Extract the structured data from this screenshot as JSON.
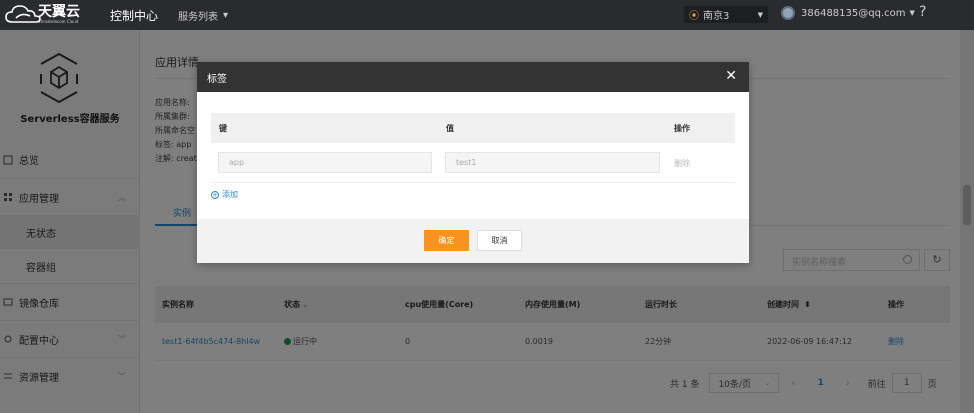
{
  "topbar": {
    "logo_cn": "天翼云",
    "logo_en": "Chinatelecom Cloud",
    "console": "控制中心",
    "services": "服务列表",
    "region": "南京3",
    "user_email": "386488135@qq.com",
    "help": "?"
  },
  "sidebar": {
    "service_title": "Serverless容器服务",
    "items": {
      "overview": "总览",
      "app_mgmt": "应用管理",
      "stateless": "无状态",
      "container_group": "容器组",
      "image_repo": "镜像仓库",
      "config_center": "配置中心",
      "resource_mgmt": "资源管理"
    }
  },
  "main": {
    "title": "应用详情",
    "info": {
      "app_name": "应用名称:",
      "cluster": "所属集群:",
      "namespace": "所属命名空",
      "labels": "标签: app",
      "annotations": "注解: creat"
    },
    "tab_instances": "实例",
    "search_placeholder": "实例名称搜索",
    "table": {
      "headers": [
        "实例名称",
        "状态",
        "cpu使用量(Core)",
        "内存使用量(M)",
        "运行时长",
        "创建时间",
        "操作"
      ],
      "rows": [
        {
          "name": "test1-64f4b5c474-8hl4w",
          "status": "运行中",
          "cpu": "0",
          "memory": "0.0019",
          "uptime": "22分钟",
          "created": "2022-06-09 16:47:12",
          "action": "删除"
        }
      ]
    },
    "pager": {
      "total": "共 1 条",
      "page_size": "10条/页",
      "current_page": "1",
      "goto_label": "前往",
      "goto_value": "1",
      "page_suffix": "页"
    }
  },
  "dialog": {
    "title": "标签",
    "col_key": "键",
    "col_value": "值",
    "col_action": "操作",
    "row": {
      "key_placeholder": "app",
      "value_placeholder": "test1",
      "delete": "删除"
    },
    "add": "添加",
    "ok": "确定",
    "cancel": "取消"
  },
  "colors": {
    "topbar": "#2a2b2f",
    "accent": "#2b8ccf",
    "primary_button": "#f7931e",
    "running": "#1f9a4a"
  }
}
